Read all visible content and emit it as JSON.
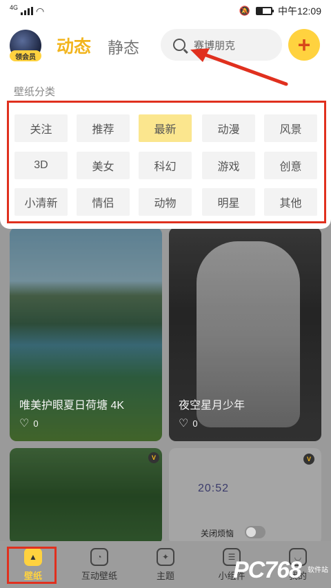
{
  "status_bar": {
    "network": "4G",
    "time": "中午12:09"
  },
  "header": {
    "vip_badge": "领会员",
    "tab_dynamic": "动态",
    "tab_static": "静态",
    "search_placeholder": "赛博朋克",
    "add_label": "+"
  },
  "categories": {
    "title": "壁纸分类",
    "items": [
      "关注",
      "推荐",
      "最新",
      "动漫",
      "风景",
      "3D",
      "美女",
      "科幻",
      "游戏",
      "创意",
      "小清新",
      "情侣",
      "动物",
      "明星",
      "其他"
    ],
    "active": "最新"
  },
  "cards": [
    {
      "title": "唯美护眼夏日荷塘 4K",
      "likes": "0"
    },
    {
      "title": "夜空星月少年",
      "likes": "0"
    },
    {
      "badge": "V"
    },
    {
      "badge": "V",
      "clock": "20:52",
      "toggle_label": "关闭烦恼"
    }
  ],
  "bottom_nav": {
    "items": [
      "壁纸",
      "互动壁纸",
      "主题",
      "小组件",
      "我的"
    ],
    "active": "壁纸"
  },
  "watermark": {
    "text": "PC768",
    "sub": "软件站"
  },
  "colors": {
    "accent": "#f2b51e",
    "highlight": "#e0301e",
    "active_category": "#fbe68e"
  }
}
